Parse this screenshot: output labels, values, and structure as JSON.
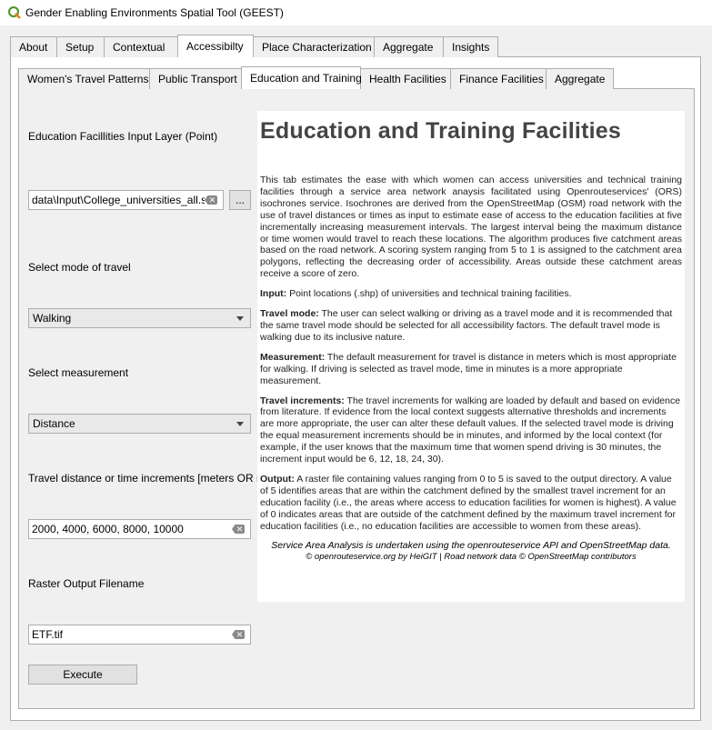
{
  "window": {
    "title": "Gender Enabling Environments Spatial Tool (GEEST)"
  },
  "outer_tabs": [
    "About",
    "Setup",
    "Contextual",
    "Accessibilty",
    "Place Characterization",
    "Aggregate",
    "Insights"
  ],
  "inner_tabs": [
    "Women's Travel Patterns",
    "Public Transport",
    "Education and Training",
    "Health Facilities",
    "Finance Facilities",
    "Aggregate"
  ],
  "form": {
    "input_layer_label": "Education Facillities Input Layer (Point)",
    "input_layer_value": "data\\Input\\College_universities_all.shp",
    "browse_label": "...",
    "travel_mode_label": "Select mode of travel",
    "travel_mode_value": "Walking",
    "measurement_label": "Select measurement",
    "measurement_value": "Distance",
    "increments_label": "Travel distance or time increments [meters OR min]",
    "increments_value": "2000, 4000, 6000, 8000, 10000",
    "output_label": "Raster Output Filename",
    "output_value": "ETF.tif",
    "execute_label": "Execute"
  },
  "help": {
    "title": "Education and Training Facilities",
    "intro": "This tab estimates the ease with which women can access universities and technical training facilities through a service area network anaysis facilitated using Openrouteservices' (ORS) isochrones service. Isochrones are derived from the OpenStreetMap (OSM) road network with the use of travel distances or times as input to estimate ease of access to the education facilities at five incrementally increasing measurement intervals. The largest interval being the maximum distance or time women would travel to reach these locations. The algorithm produces five catchment areas based on the road network. A scoring system ranging from 5 to 1 is assigned to the catchment area polygons, reflecting the decreasing order of accessibility. Areas outside these catchment areas receive a score of zero.",
    "input_head": "Input:",
    "input_text": " Point locations (.shp) of universities and technical training facilities.",
    "travel_mode_head": "Travel mode:",
    "travel_mode_text": " The user can select walking or driving as a travel mode and it is recommended that the same travel mode should be selected for all accessibility factors. The default travel mode is walking due to its inclusive nature.",
    "measurement_head": "Measurement:",
    "measurement_text": " The default measurement for travel is distance in meters which is most appropriate for walking. If driving is selected as travel mode, time in minutes is a more appropriate measurement.",
    "increments_head": "Travel increments:",
    "increments_text": " The travel increments for walking are loaded by default and based on evidence from literature. If evidence from the local context suggests alternative thresholds and increments are more appropriate, the user can alter these default values. If the selected travel mode is driving the equal measurement increments should be in minutes, and informed by the local context (for example, if the user knows that the maximum time that women spend driving is 30 minutes, the increment input would be 6, 12, 18, 24, 30).",
    "output_head": "Output:",
    "output_text": " A raster file containing values ranging from 0 to 5 is saved to the output directory. A value of 5 identifies areas that are within the catchment defined by the smallest travel increment for an education facility (i.e., the areas where access to education facilities for women is highest). A value of 0 indicates areas that are outside of the catchment defined by the maximum travel increment for education facilities (i.e., no education facilities are accessible to women from these areas).",
    "credit_line1": "Service Area Analysis is undertaken using the openrouteservice API and OpenStreetMap data.",
    "credit_line2": "© openrouteservice.org by HeiGIT | Road network data © OpenStreetMap contributors"
  }
}
